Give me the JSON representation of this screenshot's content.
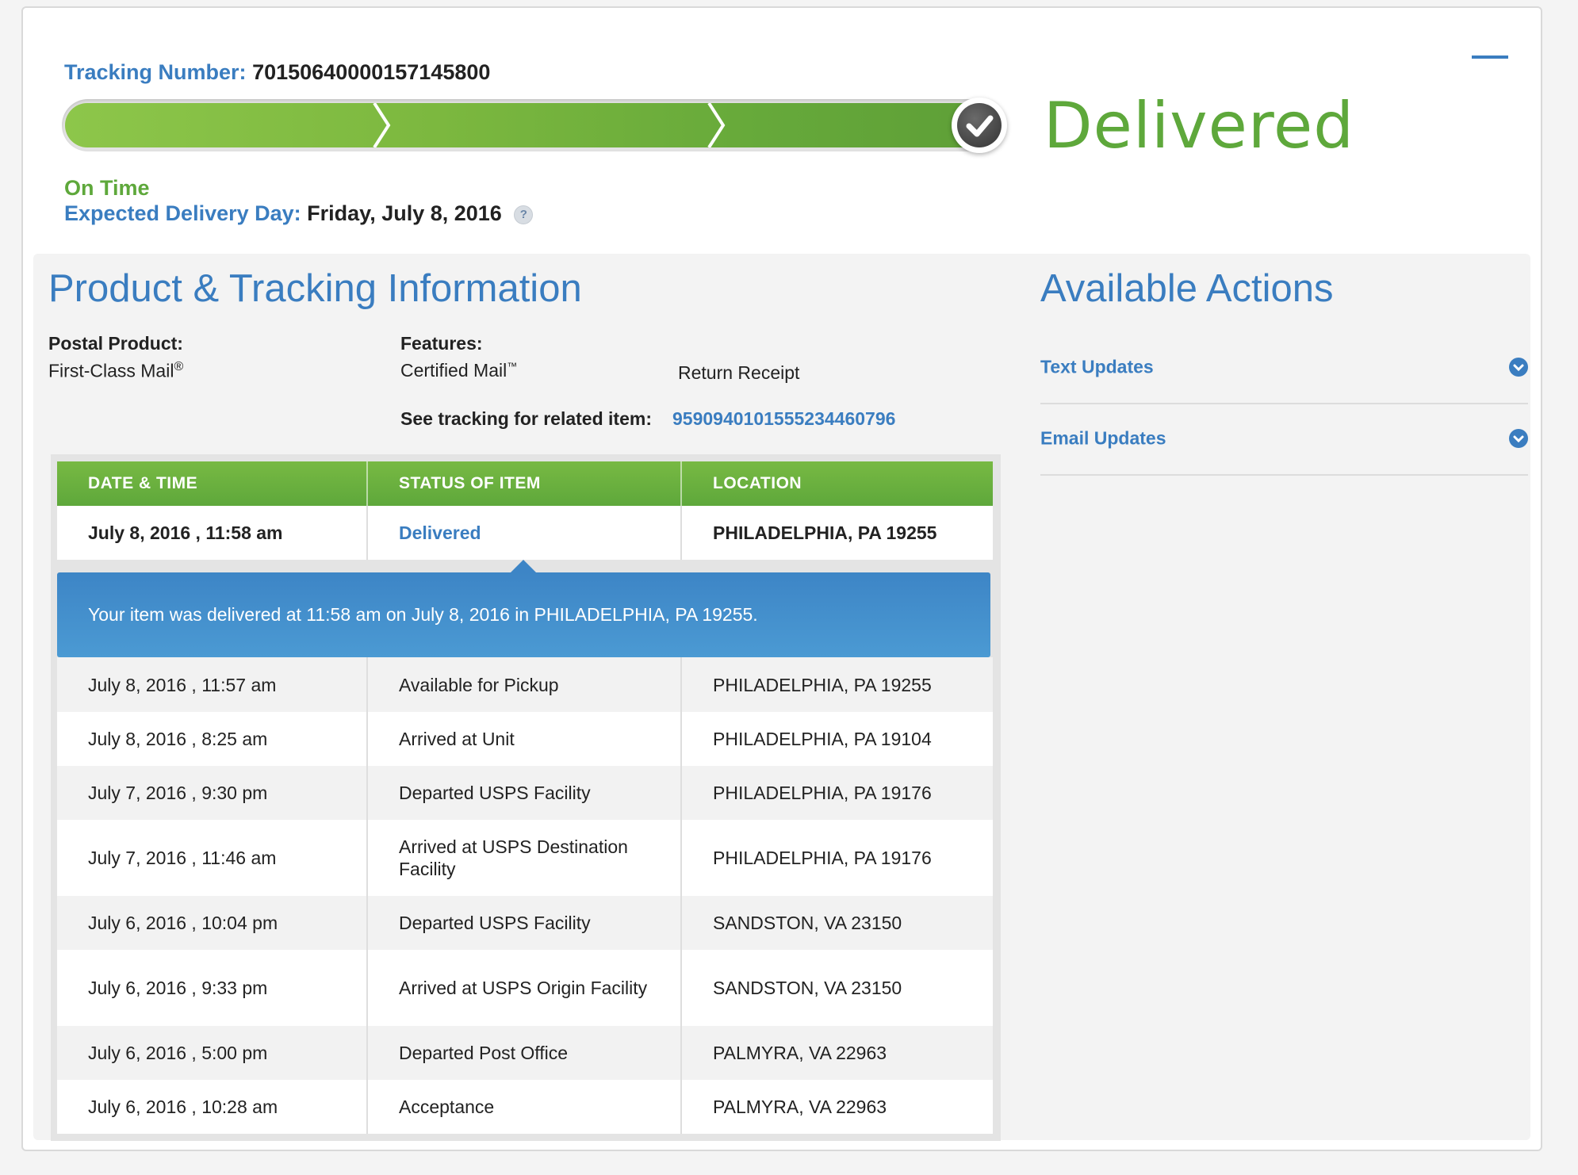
{
  "header": {
    "tracking_label": "Tracking Number:",
    "tracking_number": "70150640000157145800",
    "status_big": "Delivered",
    "on_time": "On Time",
    "expected_label": "Expected Delivery Day:",
    "expected_value": "Friday, July 8, 2016",
    "help_glyph": "?",
    "progress_percent": 100
  },
  "product": {
    "heading": "Product & Tracking Information",
    "postal_product_label": "Postal Product:",
    "postal_product_value": "First-Class Mail",
    "postal_product_mark": "®",
    "features_label": "Features:",
    "feature_1": "Certified Mail",
    "feature_1_mark": "™",
    "feature_2": "Return Receipt",
    "related_label": "See tracking for related item:",
    "related_number": "9590940101555234460796"
  },
  "actions": {
    "heading": "Available Actions",
    "items": [
      {
        "label": "Text Updates"
      },
      {
        "label": "Email Updates"
      }
    ]
  },
  "table": {
    "headers": [
      "DATE & TIME",
      "STATUS OF ITEM",
      "LOCATION"
    ],
    "latest": {
      "date": "July 8, 2016 , 11:58 am",
      "status": "Delivered",
      "location": "PHILADELPHIA, PA 19255"
    },
    "callout": "Your item was delivered at 11:58 am on July 8, 2016 in PHILADELPHIA, PA 19255.",
    "rows": [
      {
        "date": "July 8, 2016 , 11:57 am",
        "status": "Available for Pickup",
        "location": "PHILADELPHIA, PA 19255"
      },
      {
        "date": "July 8, 2016 , 8:25 am",
        "status": "Arrived at Unit",
        "location": "PHILADELPHIA, PA 19104"
      },
      {
        "date": "July 7, 2016 , 9:30 pm",
        "status": "Departed USPS Facility",
        "location": "PHILADELPHIA, PA 19176"
      },
      {
        "date": "July 7, 2016 , 11:46 am",
        "status": "Arrived at USPS Destination Facility",
        "location": "PHILADELPHIA, PA 19176"
      },
      {
        "date": "July 6, 2016 , 10:04 pm",
        "status": "Departed USPS Facility",
        "location": "SANDSTON, VA 23150"
      },
      {
        "date": "July 6, 2016 , 9:33 pm",
        "status": "Arrived at USPS Origin Facility",
        "location": "SANDSTON, VA 23150"
      },
      {
        "date": "July 6, 2016 , 5:00 pm",
        "status": "Departed Post Office",
        "location": "PALMYRA, VA 22963"
      },
      {
        "date": "July 6, 2016 , 10:28 am",
        "status": "Acceptance",
        "location": "PALMYRA, VA 22963"
      }
    ]
  },
  "colors": {
    "brand_blue": "#3a7dc0",
    "success_green": "#5ea83b",
    "callout_blue": "#3d85c6"
  },
  "icons": [
    "collapse-icon",
    "check-icon",
    "help-icon",
    "chevron-down-icon"
  ]
}
